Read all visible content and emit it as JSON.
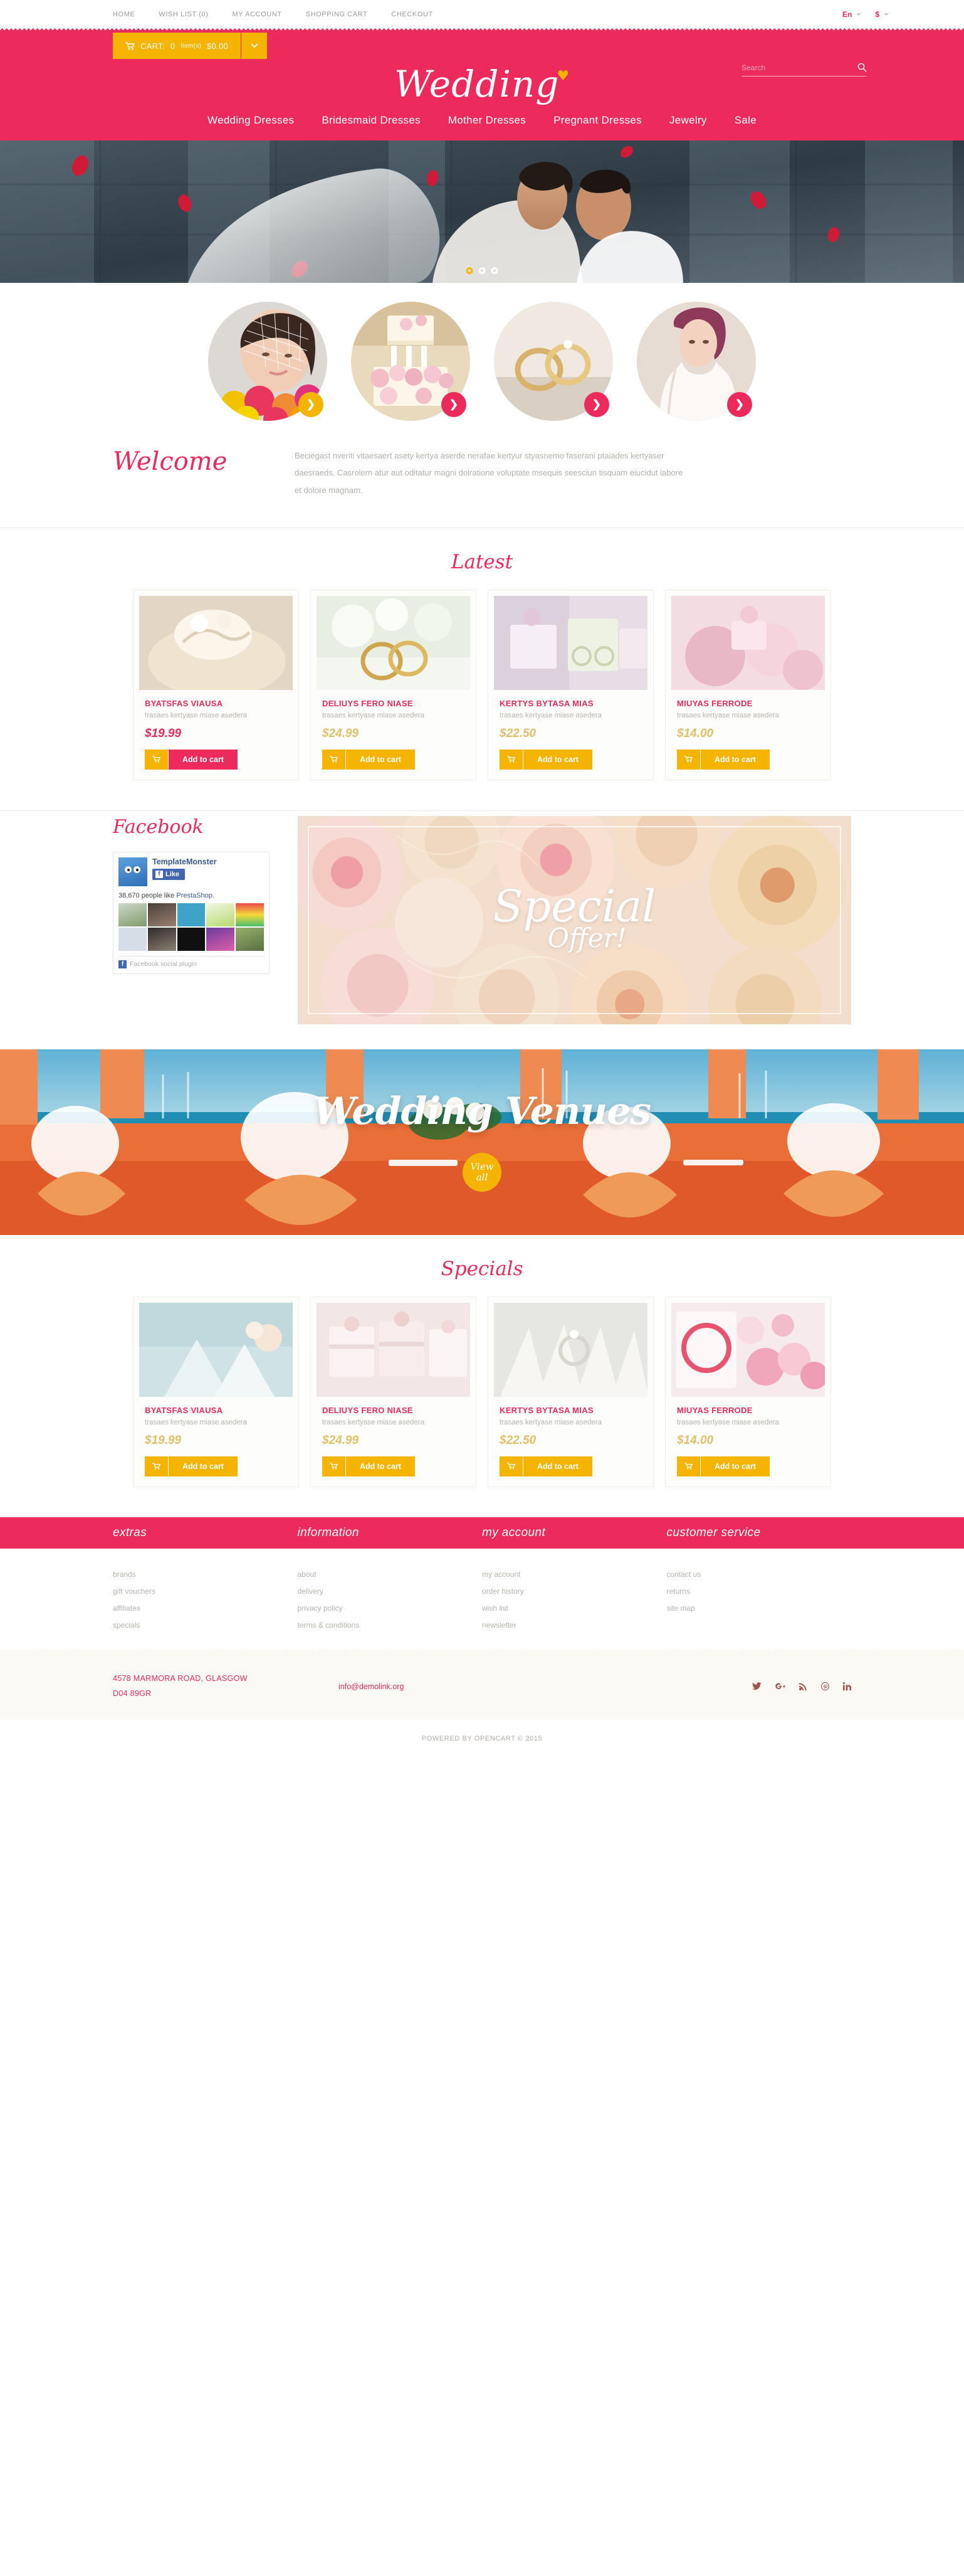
{
  "topbar": {
    "links": [
      {
        "label": "HOME"
      },
      {
        "label": "WISH LIST (0)"
      },
      {
        "label": "MY ACCOUNT"
      },
      {
        "label": "SHOPPING CART"
      },
      {
        "label": "CHECKOUT"
      }
    ],
    "language": "En",
    "currency": "$"
  },
  "header": {
    "cart_label": "CART:",
    "cart_items": "0",
    "cart_items_suffix": "item(s)",
    "cart_total": "$0.00",
    "search_placeholder": "Search",
    "search_value": "",
    "logo_text": "Wedding",
    "logo_heart": "♥",
    "nav": [
      {
        "label": "Wedding Dresses"
      },
      {
        "label": "Bridesmaid Dresses"
      },
      {
        "label": "Mother Dresses"
      },
      {
        "label": "Pregnant Dresses"
      },
      {
        "label": "Jewelry"
      },
      {
        "label": "Sale"
      }
    ]
  },
  "hero": {
    "slides": 3,
    "active_slide": 1
  },
  "categories": [
    {
      "name": "bride-veil-flowers",
      "arrow": "❯",
      "accent": "#f5b400"
    },
    {
      "name": "wedding-cake",
      "arrow": "❯",
      "accent": "#ec2a5b"
    },
    {
      "name": "wedding-rings",
      "arrow": "❯",
      "accent": "#ec2a5b"
    },
    {
      "name": "bride-dress",
      "arrow": "❯",
      "accent": "#ec2a5b"
    }
  ],
  "welcome": {
    "title": "Welcome",
    "body": "Beciegast nveriti vitaesaert asety kertya aserde nerafae kertyur styasnemo faserani ptaiades kertyaser daesraeds. Casrolern atur aut oditatur magni dolratione voluptate msequis seesciun tisquam eiucidut labore et dolore magnam."
  },
  "latest": {
    "title": "Latest",
    "products": [
      {
        "name": "BYATSFAS VIAUSA",
        "desc": "trasaes kertyase miase asedera",
        "price": "$19.99",
        "price_color": "pink",
        "btn_color": "pink",
        "add_label": "Add to cart",
        "cart_icon": "🛒"
      },
      {
        "name": "DELIUYS FERO NIASE",
        "desc": "trasaes kertyase miase asedera",
        "price": "$24.99",
        "price_color": "gold",
        "btn_color": "gold",
        "add_label": "Add to cart",
        "cart_icon": "🛒"
      },
      {
        "name": "KERTYS BYTASA MIAS",
        "desc": "trasaes kertyase miase asedera",
        "price": "$22.50",
        "price_color": "gold",
        "btn_color": "gold",
        "add_label": "Add to cart",
        "cart_icon": "🛒"
      },
      {
        "name": "MIUYAS FERRODE",
        "desc": "trasaes kertyase miase asedera",
        "price": "$14.00",
        "price_color": "gold",
        "btn_color": "gold",
        "add_label": "Add to cart",
        "cart_icon": "🛒"
      }
    ]
  },
  "facebook": {
    "title": "Facebook",
    "page_name": "TemplateMonster",
    "like_label": "Like",
    "like_f": "f",
    "count_text": "38,670 people like ",
    "count_link": "PrestaShop.",
    "plugin_label": "Facebook social plugin",
    "plugin_f": "f"
  },
  "special_banner": {
    "line1": "Special",
    "line2": "Offer!"
  },
  "venues": {
    "title": "Wedding Venues",
    "cta_line1": "View",
    "cta_line2": "all"
  },
  "specials": {
    "title": "Specials",
    "products": [
      {
        "name": "BYATSFAS VIAUSA",
        "desc": "trasaes kertyase miase asedera",
        "price": "$19.99",
        "price_color": "gold",
        "btn_color": "gold",
        "add_label": "Add to cart",
        "cart_icon": "🛒"
      },
      {
        "name": "DELIUYS FERO NIASE",
        "desc": "trasaes kertyase miase asedera",
        "price": "$24.99",
        "price_color": "gold",
        "btn_color": "gold",
        "add_label": "Add to cart",
        "cart_icon": "🛒"
      },
      {
        "name": "KERTYS BYTASA MIAS",
        "desc": "trasaes kertyase miase asedera",
        "price": "$22.50",
        "price_color": "gold",
        "btn_color": "gold",
        "add_label": "Add to cart",
        "cart_icon": "🛒"
      },
      {
        "name": "MIUYAS FERRODE",
        "desc": "trasaes kertyase miase asedera",
        "price": "$14.00",
        "price_color": "gold",
        "btn_color": "gold",
        "add_label": "Add to cart",
        "cart_icon": "🛒"
      }
    ]
  },
  "footer": {
    "columns": [
      {
        "heading": "extras",
        "links": [
          {
            "label": "brands"
          },
          {
            "label": "gift vouchers"
          },
          {
            "label": "affiliates"
          },
          {
            "label": "specials"
          }
        ]
      },
      {
        "heading": "information",
        "links": [
          {
            "label": "about"
          },
          {
            "label": "delivery"
          },
          {
            "label": "privacy policy"
          },
          {
            "label": "terms & conditions"
          }
        ]
      },
      {
        "heading": "my account",
        "links": [
          {
            "label": "my account"
          },
          {
            "label": "order history"
          },
          {
            "label": "wish list"
          },
          {
            "label": "newsletter"
          }
        ]
      },
      {
        "heading": "customer service",
        "links": [
          {
            "label": "contact us"
          },
          {
            "label": "returns"
          },
          {
            "label": "site map"
          }
        ]
      }
    ],
    "address_line1": "4578 MARMORA ROAD, GLASGOW",
    "address_line2": "D04 89GR",
    "email": "info@demolink.org",
    "social": [
      {
        "name": "twitter-icon",
        "glyph": "𝐭"
      },
      {
        "name": "google-plus-icon",
        "glyph": "g"
      },
      {
        "name": "rss-icon",
        "glyph": "≋"
      },
      {
        "name": "pinterest-icon",
        "glyph": "Ⓟ"
      },
      {
        "name": "linkedin-icon",
        "glyph": "in"
      }
    ],
    "copyright": "POWERED BY OPENCART © 2015"
  },
  "colors": {
    "brand_pink": "#ec2a5b",
    "brand_gold": "#f5b400",
    "price_gold": "#e0c169",
    "text_muted": "#b5b0ab"
  }
}
